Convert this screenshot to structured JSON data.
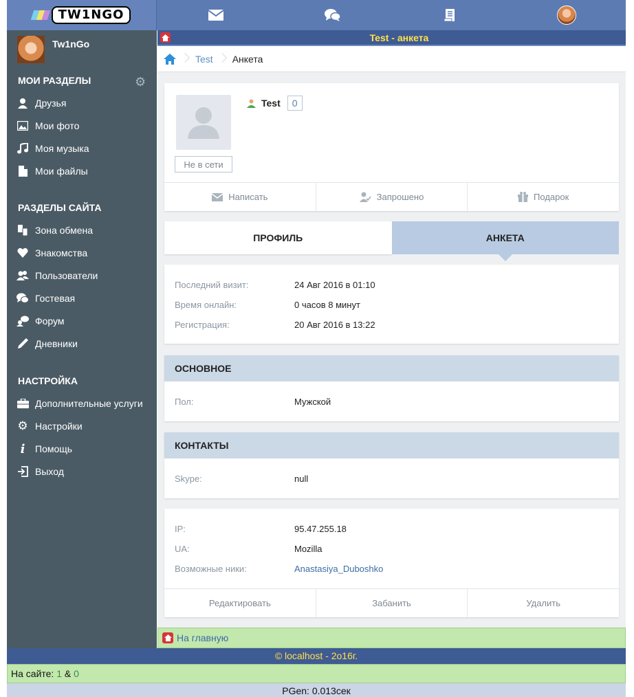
{
  "header": {
    "logo_text": "TW1NGO",
    "nav_icons": [
      "mail-icon",
      "chat-icon",
      "notes-icon",
      "avatar"
    ]
  },
  "sidebar": {
    "user_name": "Tw1nGo",
    "sections": {
      "my": "Мои разделы",
      "site": "Разделы сайта",
      "settings": "Настройка"
    },
    "my_items": [
      {
        "label": "Друзья",
        "icon": "user-icon"
      },
      {
        "label": "Мои фото",
        "icon": "photo-icon"
      },
      {
        "label": "Моя музыка",
        "icon": "music-icon"
      },
      {
        "label": "Мои файлы",
        "icon": "file-icon"
      }
    ],
    "site_items": [
      {
        "label": "Зона обмена",
        "icon": "exchange-icon"
      },
      {
        "label": "Знакомства",
        "icon": "heart-icon"
      },
      {
        "label": "Пользователи",
        "icon": "users-icon"
      },
      {
        "label": "Гостевая",
        "icon": "comments-icon"
      },
      {
        "label": "Форум",
        "icon": "forum-icon"
      },
      {
        "label": "Дневники",
        "icon": "pen-icon"
      }
    ],
    "settings_items": [
      {
        "label": "Дополнительные услуги",
        "icon": "briefcase-icon"
      },
      {
        "label": "Настройки",
        "icon": "gear-icon"
      },
      {
        "label": "Помощь",
        "icon": "info-icon"
      },
      {
        "label": "Выход",
        "icon": "logout-icon"
      }
    ]
  },
  "page": {
    "title": "Test - анкета",
    "breadcrumb": {
      "link": "Test",
      "current": "Анкета"
    }
  },
  "profile": {
    "name": "Test",
    "count": "0",
    "status": "Не в сети",
    "actions": [
      "Написать",
      "Запрошено",
      "Подарок"
    ]
  },
  "tabs": {
    "profile": "Профиль",
    "questionnaire": "Анкета"
  },
  "visits": [
    {
      "key": "Последний визит:",
      "value": "24 Авг 2016 в 01:10"
    },
    {
      "key": "Время онлайн:",
      "value": "0 часов 8 минут"
    },
    {
      "key": "Регистрация:",
      "value": "20 Авг 2016 в 13:22"
    }
  ],
  "basic": {
    "title": "Основное",
    "rows": [
      {
        "key": "Пол:",
        "value": "Мужской"
      }
    ]
  },
  "contacts": {
    "title": "Контакты",
    "rows": [
      {
        "key": "Skype:",
        "value": "null"
      }
    ]
  },
  "tech": {
    "rows": [
      {
        "key": "IP:",
        "value": "95.47.255.18"
      },
      {
        "key": "UA:",
        "value": "Mozilla"
      },
      {
        "key": "Возможные ники:",
        "value": "Anastasiya_Duboshko"
      }
    ],
    "actions": [
      "Редактировать",
      "Забанить",
      "Удалить"
    ]
  },
  "footer": {
    "home_link": "На главную",
    "copyright": "© localhost - 2o16г.",
    "online_label": "На сайте:",
    "online_users": "1",
    "online_amp": "&",
    "online_guests": "0",
    "pgen": "PGen: 0.013сек"
  },
  "colors": {
    "topbar": "#5d7bb3",
    "sidebar": "#4b5b65",
    "title_strip": "#3f5b93",
    "title_text": "#ffe04a",
    "active_tab": "#b8cbe2",
    "section_head": "#cbd8e6",
    "green_strip": "#c2e8ad"
  }
}
